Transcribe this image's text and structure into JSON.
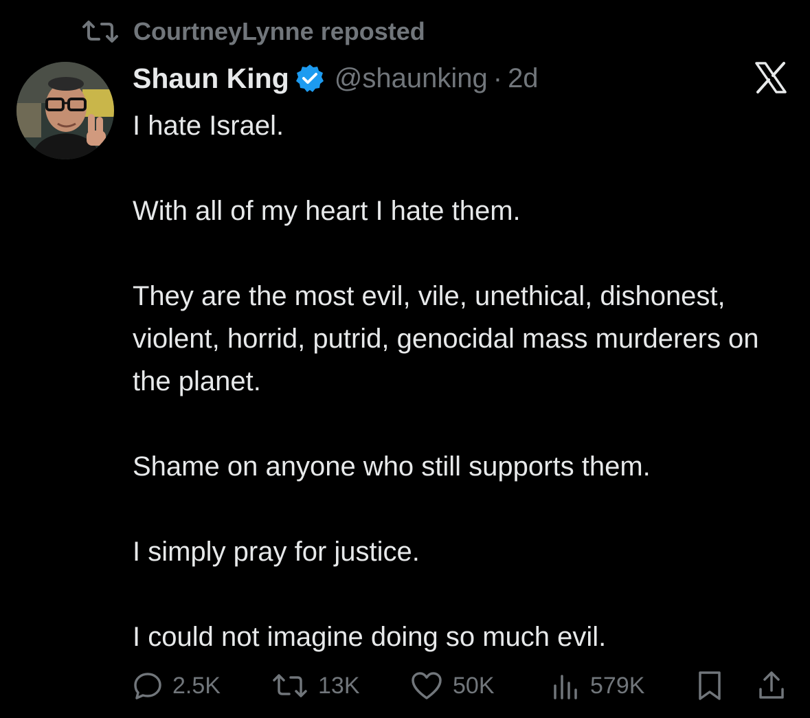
{
  "repost": {
    "icon": "repost-icon",
    "label": "CourtneyLynne reposted"
  },
  "author": {
    "avatar_icon": "avatar-photo",
    "display_name": "Shaun King",
    "verified_icon": "verified-badge-icon",
    "handle": "@shaunking",
    "separator": "·",
    "time": "2d"
  },
  "brand": {
    "logo_icon": "x-logo-icon"
  },
  "tweet": {
    "paragraphs": [
      "I hate Israel.",
      "With all of my heart I hate them.",
      "They are the most evil, vile, unethical, dishonest, violent, horrid, putrid, genocidal mass murderers on the planet.",
      "Shame on anyone who still supports them.",
      "I simply pray for justice.",
      "I could not imagine doing so much evil."
    ]
  },
  "actions": {
    "reply": {
      "icon": "reply-icon",
      "count": "2.5K"
    },
    "repost": {
      "icon": "repost-icon",
      "count": "13K"
    },
    "like": {
      "icon": "heart-icon",
      "count": "50K"
    },
    "views": {
      "icon": "views-icon",
      "count": "579K"
    },
    "bookmark": {
      "icon": "bookmark-icon"
    },
    "share": {
      "icon": "share-icon"
    }
  },
  "colors": {
    "background": "#000000",
    "primary_text": "#e7e9ea",
    "secondary_text": "#71767b",
    "verified_blue": "#1d9bf0"
  }
}
